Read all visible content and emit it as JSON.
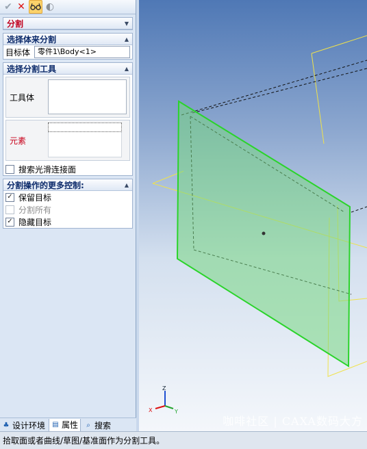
{
  "toolbar": {
    "ok_icon": "check-icon",
    "cancel_icon": "cancel-x-icon",
    "preview_icon": "preview-glasses-icon",
    "help_icon": "help-disc-icon"
  },
  "panel_title": "分割",
  "section1": {
    "title": "选择体来分割",
    "target_label": "目标体",
    "target_value": "零件1\\Body<1>"
  },
  "section2": {
    "title": "选择分割工具",
    "tool_body_label": "工具体",
    "element_label": "元素",
    "smooth_label": "搜索光滑连接面"
  },
  "section3": {
    "title": "分割操作的更多控制:",
    "keep_target": "保留目标",
    "split_all": "分割所有",
    "hide_target": "隐藏目标"
  },
  "tabs": [
    "设计环境",
    "属性",
    "搜索"
  ],
  "status_text": "拾取面或者曲线/草图/基准面作为分割工具。",
  "watermark": "咖啡社区 | CAXA数码大方",
  "axes": {
    "x": "X",
    "y": "Y",
    "z": "Z"
  },
  "colors": {
    "panel_bg": "#dbe6f4",
    "title_red": "#c0001e",
    "header_blue": "#0c2a6a",
    "plane_green": "#2ad42a",
    "wire_yellow": "#f0e24a"
  }
}
